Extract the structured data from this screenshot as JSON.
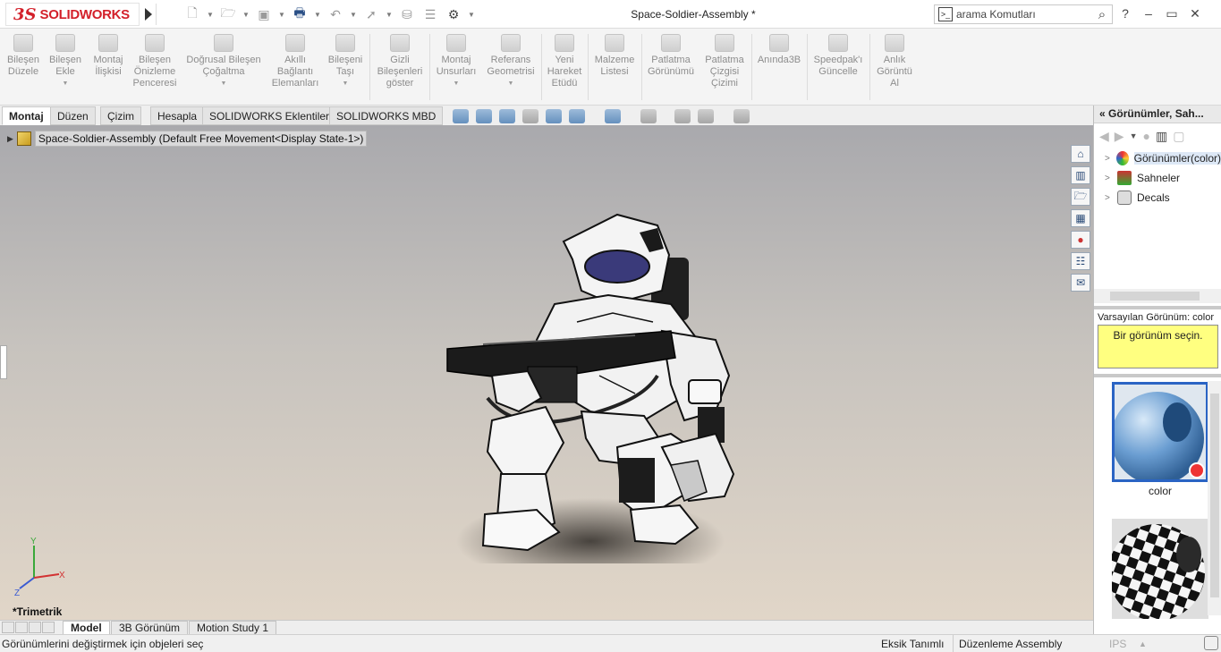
{
  "app": {
    "logo_ds": "3S",
    "logo_name": "SOLIDWORKS",
    "document_title": "Space-Soldier-Assembly *"
  },
  "search": {
    "placeholder": "arama Komutları"
  },
  "window_controls": {
    "help": "?",
    "minimize": "–",
    "restore": "▭",
    "close": "✕"
  },
  "ribbon": {
    "buttons": [
      {
        "label": "Bileşen\nDüzele"
      },
      {
        "label": "Bileşen\nEkle"
      },
      {
        "label": "Montaj\nİlişkisi"
      },
      {
        "label": "Bileşen\nÖnizleme\nPenceresi"
      },
      {
        "label": "Doğrusal Bileşen\nÇoğaltma"
      },
      {
        "label": "Akıllı\nBağlantı\nElemanları"
      },
      {
        "label": "Bileşeni\nTaşı"
      },
      {
        "label": "Gizli\nBileşenleri\ngöster"
      },
      {
        "label": "Montaj\nUnsurları"
      },
      {
        "label": "Referans\nGeometrisi"
      },
      {
        "label": "Yeni\nHareket\nEtüdü"
      },
      {
        "label": "Malzeme\nListesi"
      },
      {
        "label": "Patlatma\nGörünümü"
      },
      {
        "label": "Patlatma\nÇizgisi\nÇizimi"
      },
      {
        "label": "Anında3B"
      },
      {
        "label": "Speedpak'ı\nGüncelle"
      },
      {
        "label": "Anlık\nGörüntü\nAl"
      }
    ]
  },
  "tabs": [
    "Montaj",
    "Düzen",
    "Çizim",
    "Hesapla",
    "SOLIDWORKS Eklentileri",
    "SOLIDWORKS MBD"
  ],
  "tree": {
    "root_label": "Space-Soldier-Assembly  (Default Free Movement<Display State-1>)"
  },
  "viewport": {
    "view_name": "*Trimetrik",
    "triad": {
      "x": "X",
      "y": "Y",
      "z": "Z"
    }
  },
  "right_panel": {
    "title": "Görünümler, Sah...",
    "items": [
      {
        "label": "Görünümler(color)"
      },
      {
        "label": "Sahneler"
      },
      {
        "label": "Decals"
      }
    ],
    "default_appearance": "Varsayılan Görünüm: color",
    "note": "Bir görünüm seçin.",
    "thumbnail_label": "color"
  },
  "bottom_tabs": [
    "Model",
    "3B Görünüm",
    "Motion Study 1"
  ],
  "status": {
    "message": "Görünümlerini değiştirmek için objeleri seç",
    "under_defined": "Eksik Tanımlı",
    "mode": "Düzenleme Assembly",
    "units": "IPS"
  }
}
